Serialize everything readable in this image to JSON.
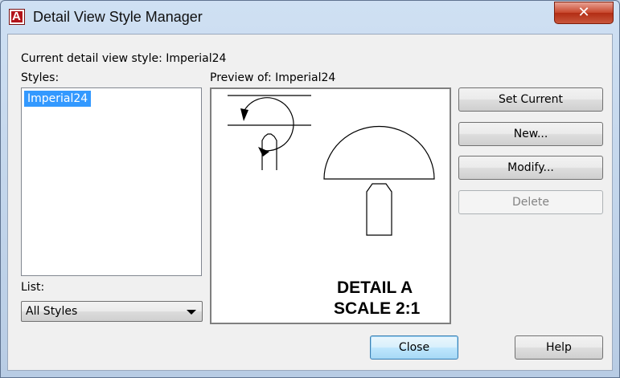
{
  "window": {
    "title": "Detail View Style Manager",
    "close_glyph": "✕"
  },
  "current_style": {
    "label": "Current detail view style: Imperial24"
  },
  "styles": {
    "label": "Styles:",
    "items": [
      "Imperial24"
    ],
    "selected": "Imperial24"
  },
  "list": {
    "label": "List:",
    "selected": "All Styles"
  },
  "preview": {
    "label": "Preview of: Imperial24",
    "detail_line1": "DETAIL A",
    "detail_line2": "SCALE 2:1"
  },
  "buttons": {
    "set_current": "Set Current",
    "new": "New...",
    "modify": "Modify...",
    "delete": "Delete",
    "close": "Close",
    "help": "Help"
  },
  "icons": {
    "app": "autocad-app-icon",
    "app_letter": "A",
    "close": "close-icon",
    "dropdown": "chevron-down-icon"
  },
  "colors": {
    "selection": "#3399ff",
    "close_button": "#c7452b",
    "app_icon": "#b3141b"
  }
}
